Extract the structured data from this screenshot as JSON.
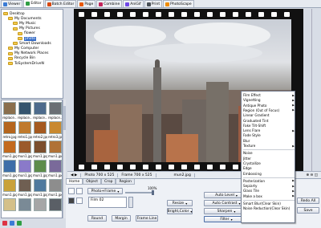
{
  "tabs": [
    {
      "label": "Viewer",
      "color": "#3a7bd5"
    },
    {
      "label": "Editor",
      "color": "#2f9e44",
      "active": true
    },
    {
      "label": "Batch Editor",
      "color": "#d9480f"
    },
    {
      "label": "Page",
      "color": "#e8590c"
    },
    {
      "label": "Combine",
      "color": "#c2255c"
    },
    {
      "label": "AniGif",
      "color": "#7048e8"
    },
    {
      "label": "Print",
      "color": "#495057"
    },
    {
      "label": "PhotoScape",
      "color": "#f08c00"
    }
  ],
  "tree": [
    {
      "label": "Desktop",
      "indent": 0
    },
    {
      "label": "My Documents",
      "indent": 1
    },
    {
      "label": "My Music",
      "indent": 2
    },
    {
      "label": "My Pictures",
      "indent": 2
    },
    {
      "label": "flower",
      "indent": 3
    },
    {
      "label": "photo",
      "indent": 3,
      "selected": true
    },
    {
      "label": "Smart Downloads",
      "indent": 2
    },
    {
      "label": "My Computer",
      "indent": 1
    },
    {
      "label": "My Network Places",
      "indent": 1
    },
    {
      "label": "Recycle Bin",
      "indent": 1
    },
    {
      "label": "ToSystemDriveN",
      "indent": 1
    }
  ],
  "thumbs": [
    {
      "cap": "replace...",
      "color": "#8a6f4d"
    },
    {
      "cap": "replace...",
      "color": "#35556e"
    },
    {
      "cap": "replace...",
      "color": "#4d6b8c"
    },
    {
      "cap": "replace...",
      "color": "#6a6f74"
    },
    {
      "cap": "retro.jpg",
      "color": "#b5651d"
    },
    {
      "cap": "retro1.jpg",
      "color": "#c07a2c"
    },
    {
      "cap": "retro2.jpg",
      "color": "#a55a20"
    },
    {
      "cap": "retro3.jpg",
      "color": "#c9892f"
    },
    {
      "cap": "mun1.jpg",
      "color": "#c36a1e"
    },
    {
      "cap": "mun1.jpg",
      "color": "#9b5a2a"
    },
    {
      "cap": "mun1.jpg",
      "color": "#7b4e2d"
    },
    {
      "cap": "mun1.jpg",
      "color": "#b07236"
    },
    {
      "cap": "mun1.jpg",
      "color": "#3d6ea8"
    },
    {
      "cap": "mun1.jpg",
      "color": "#8a7ac9"
    },
    {
      "cap": "mun1.jpg",
      "color": "#5d8d4a"
    },
    {
      "cap": "mun1.jpg",
      "color": "#7a6a9a"
    },
    {
      "cap": "mun1.jpg",
      "color": "#c9a23a"
    },
    {
      "cap": "mun1.jpg",
      "color": "#6f5f52"
    },
    {
      "cap": "mun1.jpg",
      "color": "#4f7a9e"
    },
    {
      "cap": "mun1.jpg",
      "color": "#8d8d8d"
    },
    {
      "cap": "",
      "color": "#d4c089"
    },
    {
      "cap": "",
      "color": "#7a8a96"
    },
    {
      "cap": "",
      "color": "#a6a6a6"
    },
    {
      "cap": "",
      "color": "#5a5f66"
    }
  ],
  "status": {
    "photo_size": "Photo 700 x 525",
    "frame_size": "Frame 700 x 525",
    "file": "mun2.jpg"
  },
  "ribbon": {
    "tabs": [
      "Home",
      "Object",
      "Crop",
      "Region"
    ],
    "photo_frame": "Photo+Frame",
    "film": "Film 02",
    "slider_value": "100%",
    "round": "Round",
    "margin": "Margin",
    "frame_line": "Frame Line",
    "resize": "Resize",
    "bright_color": "Bright,Color",
    "auto_level": "Auto Level",
    "auto_contrast": "Auto Contrast",
    "sharpen": "Sharpen",
    "filter": "Filter",
    "redo": "Redo All",
    "save": "Save"
  },
  "menu": [
    {
      "label": "Film Effect",
      "sub": true
    },
    {
      "label": "Vignetting",
      "sub": true
    },
    {
      "label": "Antique Photo",
      "sub": true
    },
    {
      "label": "Region (Out of Focus)",
      "sub": true
    },
    {
      "label": "Linear Gradient",
      "sub": false
    },
    {
      "label": "Graduated Tint",
      "sub": false
    },
    {
      "label": "Fake Tilt-Shift",
      "sub": false
    },
    {
      "label": "Lens Flare",
      "sub": true
    },
    {
      "label": "Fade Style",
      "sub": false
    },
    {
      "label": "Blur",
      "sub": false
    },
    {
      "label": "Texture",
      "sub": true
    },
    {
      "label": "---"
    },
    {
      "label": "Noise",
      "sub": false
    },
    {
      "label": "Jitter",
      "sub": false
    },
    {
      "label": "Crystallize",
      "sub": false
    },
    {
      "label": "Edge",
      "sub": false
    },
    {
      "label": "Embossing",
      "sub": false
    },
    {
      "label": "---"
    },
    {
      "label": "Posterization",
      "sub": true
    },
    {
      "label": "Sepiarty",
      "sub": true
    },
    {
      "label": "Glass Tile",
      "sub": true
    },
    {
      "label": "Make a box",
      "sub": true
    },
    {
      "label": "---"
    },
    {
      "label": "Smart Blur(Clear Skin)",
      "sub": false
    },
    {
      "label": "Noise Reduction(Clear Skin)",
      "sub": false
    }
  ]
}
